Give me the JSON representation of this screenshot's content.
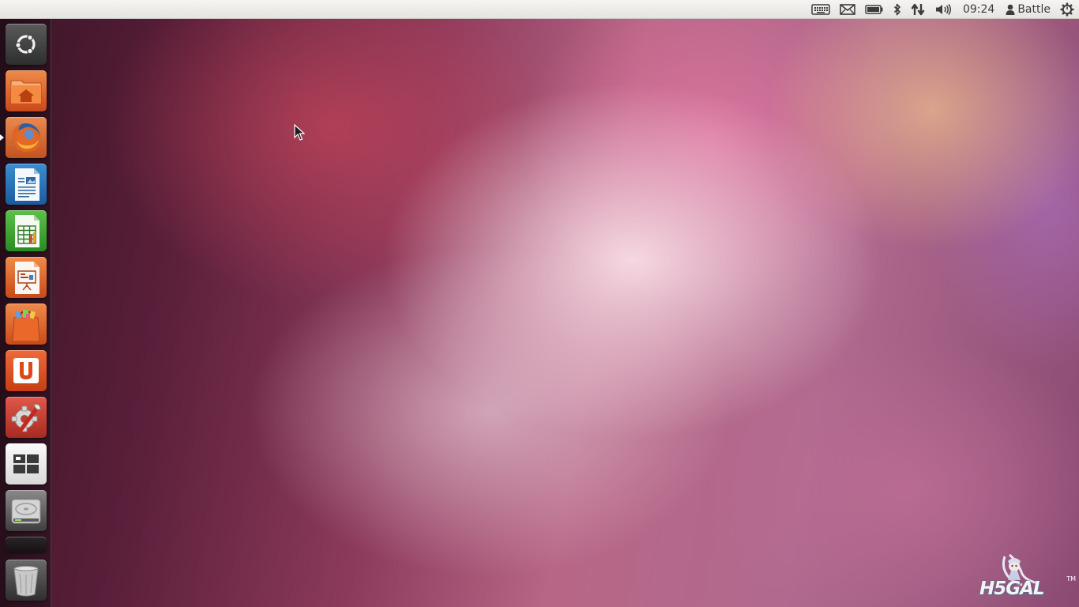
{
  "top_panel": {
    "indicators": [
      {
        "icon": "keyboard-icon"
      },
      {
        "icon": "mail-icon"
      },
      {
        "icon": "battery-icon"
      },
      {
        "icon": "bluetooth-icon"
      },
      {
        "icon": "network-icon"
      },
      {
        "icon": "volume-icon"
      }
    ],
    "clock": "09:24",
    "user": {
      "icon": "user-icon",
      "name": "Battle"
    },
    "session": {
      "icon": "power-gear-icon"
    }
  },
  "launcher": {
    "items": [
      {
        "icon": "dash-home-icon"
      },
      {
        "icon": "home-folder-icon"
      },
      {
        "icon": "firefox-icon",
        "running": true
      },
      {
        "icon": "writer-icon"
      },
      {
        "icon": "calc-icon"
      },
      {
        "icon": "impress-icon"
      },
      {
        "icon": "software-center-icon"
      },
      {
        "icon": "ubuntu-one-icon"
      },
      {
        "icon": "system-settings-icon"
      },
      {
        "icon": "workspace-switcher-icon"
      },
      {
        "icon": "hard-drive-icon"
      },
      {
        "icon": "trash-icon"
      }
    ]
  },
  "watermark": {
    "text": "H5GAL",
    "tm": "TM"
  },
  "colors": {
    "panel_bg": "#e6e4e0",
    "launcher_bg": "#2a0f1c",
    "ubuntu_orange": "#dd4814"
  }
}
